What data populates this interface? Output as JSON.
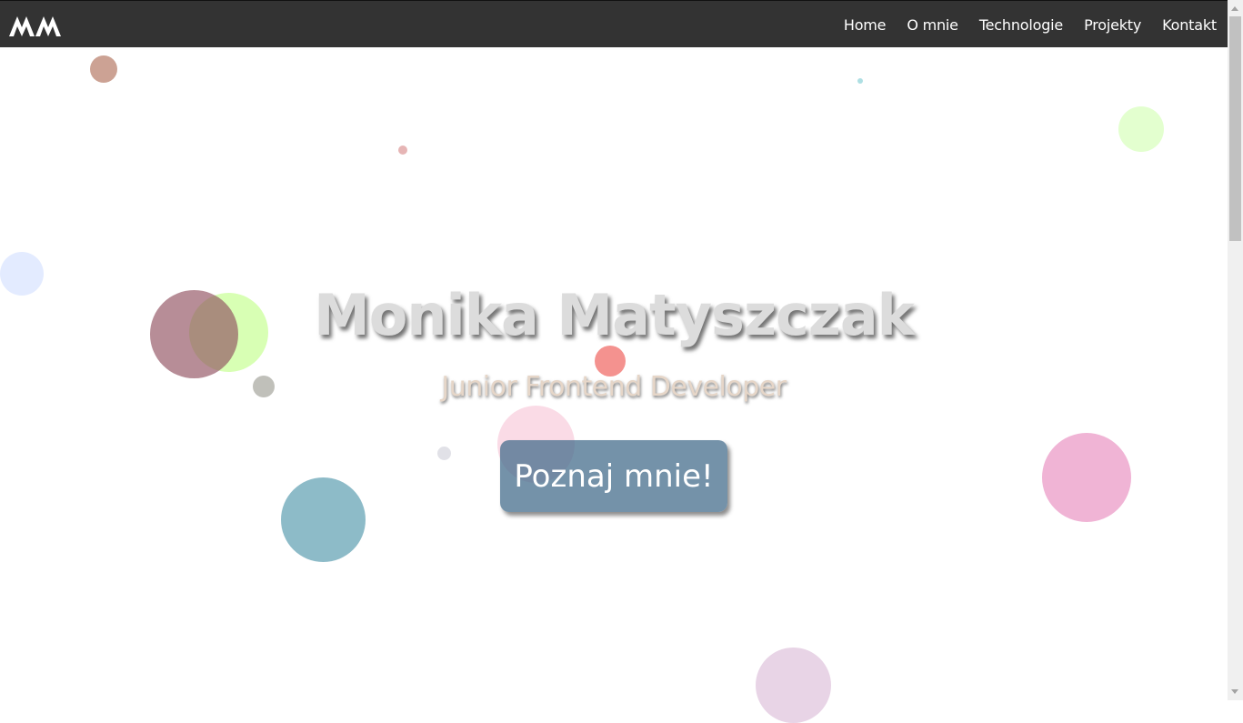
{
  "nav": {
    "logo_text": "MM",
    "items": [
      {
        "label": "Home"
      },
      {
        "label": "O mnie"
      },
      {
        "label": "Technologie"
      },
      {
        "label": "Projekty"
      },
      {
        "label": "Kontakt"
      }
    ]
  },
  "hero": {
    "name": "Monika Matyszczak",
    "subtitle": "Junior Frontend Developer",
    "cta_label": "Poznaj mnie!"
  },
  "colors": {
    "navbar": "#333333",
    "cta": "#466e8c",
    "bubbles": [
      "#b7836f",
      "#d99c9c",
      "#9fdce0",
      "#d9ffb8",
      "#d6e0ff",
      "#a06474",
      "#c8ff8c",
      "#9a9a90",
      "#f07a73",
      "#f6c9d6",
      "#d6d6dc",
      "#5b9fb0",
      "#ec9dc8",
      "#dbbcda"
    ]
  }
}
